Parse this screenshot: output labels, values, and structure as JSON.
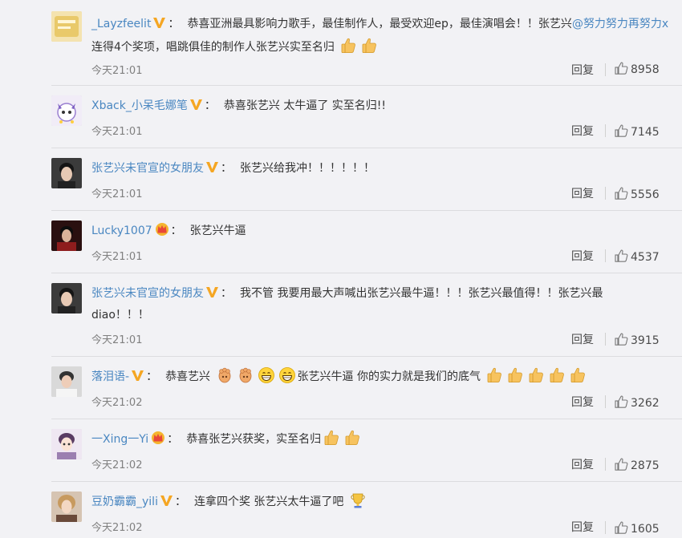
{
  "ui": {
    "reply_label": "回复",
    "colon": "：",
    "colors": {
      "link": "#4a87c1",
      "vip": "#f5a623",
      "bg": "#f2f2f5",
      "text": "#333333"
    }
  },
  "comments": [
    {
      "user": "_Layzfeelit",
      "badge": "v-badge-icon",
      "text_1": "恭喜亚洲最具影响力歌手，最佳制作人，最受欢迎ep，最佳演唱会！！张艺兴",
      "mention": "@努力努力再努力x",
      "text_2": " 连得4个奖项，唱跳俱佳的制作人张艺兴实至名归",
      "emoji": [
        "thumbs-up-icon",
        "thumbs-up-icon"
      ],
      "time": "今天21:01",
      "likes": "8958"
    },
    {
      "user": "Xback_小呆毛娜笔",
      "badge": "v-badge-icon",
      "text": "恭喜张艺兴 太牛逼了 实至名归!!",
      "time": "今天21:01",
      "likes": "7145"
    },
    {
      "user": "张艺兴未官宣的女朋友",
      "badge": "v-badge-icon",
      "text": "张艺兴给我冲！！！！！！",
      "time": "今天21:01",
      "likes": "5556"
    },
    {
      "user": "Lucky1007",
      "badge": "crown-badge-icon",
      "text": "张艺兴牛逼",
      "time": "今天21:01",
      "likes": "4537"
    },
    {
      "user": "张艺兴未官宣的女朋友",
      "badge": "v-badge-icon",
      "text_1": "我不管 我要用最大声喊出张艺兴最牛逼！！！张艺兴最值得！！张艺兴最",
      "text_2": "diao！！！",
      "time": "今天21:01",
      "likes": "3915"
    },
    {
      "user": "落泪语-",
      "badge": "v-badge-icon",
      "text_1": "恭喜艺兴",
      "emoji_1": [
        "fist-icon",
        "fist-icon",
        "grin-icon",
        "grin-icon"
      ],
      "text_2": "张艺兴牛逼 你的实力就是我们的底气",
      "emoji_2": [
        "thumbs-up-icon",
        "thumbs-up-icon",
        "thumbs-up-icon",
        "thumbs-up-icon",
        "thumbs-up-icon"
      ],
      "time": "今天21:02",
      "likes": "3262"
    },
    {
      "user": "一Xing一Yi",
      "badge": "crown-badge-icon",
      "text": "恭喜张艺兴获奖，实至名归",
      "emoji": [
        "thumbs-up-icon",
        "thumbs-up-icon"
      ],
      "time": "今天21:02",
      "likes": "2875"
    },
    {
      "user": "豆奶霸霸_yili",
      "badge": "v-badge-icon",
      "text": "连拿四个奖 张艺兴太牛逼了吧",
      "emoji": [
        "trophy-icon"
      ],
      "time": "今天21:02",
      "likes": "1605"
    }
  ]
}
